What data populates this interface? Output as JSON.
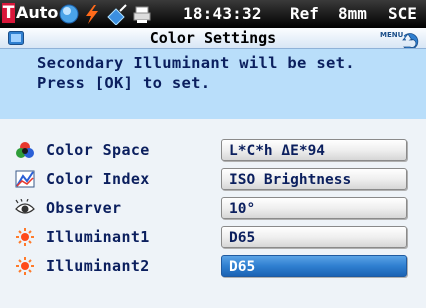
{
  "status": {
    "t_icon": "T",
    "mode": "Auto",
    "icons": [
      "measurement-globe-icon",
      "flash-icon",
      "cleaning-icon",
      "print-icon"
    ],
    "time": "18:43:32",
    "ref": "Ref",
    "aperture": "8mm",
    "specular": "SCE"
  },
  "title": {
    "text": "Color Settings",
    "menu_label": "MENU"
  },
  "message": {
    "line1": "Secondary Illuminant will be set.",
    "line2": "Press [OK] to set."
  },
  "settings": [
    {
      "label": "Color Space",
      "icon": "color-space-icon",
      "value": "L*C*h ΔE*94"
    },
    {
      "label": "Color Index",
      "icon": "color-index-icon",
      "value": "ISO Brightness"
    },
    {
      "label": "Observer",
      "icon": "observer-eye-icon",
      "value": "10°"
    },
    {
      "label": "Illuminant1",
      "icon": "illuminant-sun-icon",
      "value": "D65"
    },
    {
      "label": "Illuminant2",
      "icon": "illuminant-sun-icon",
      "value": "D65",
      "selected": true
    }
  ],
  "colors": {
    "message_bg": "#b9defa",
    "selected_field": "#2f7fd0",
    "label_text": "#0b1f5e",
    "t_icon": "#d8163a"
  }
}
